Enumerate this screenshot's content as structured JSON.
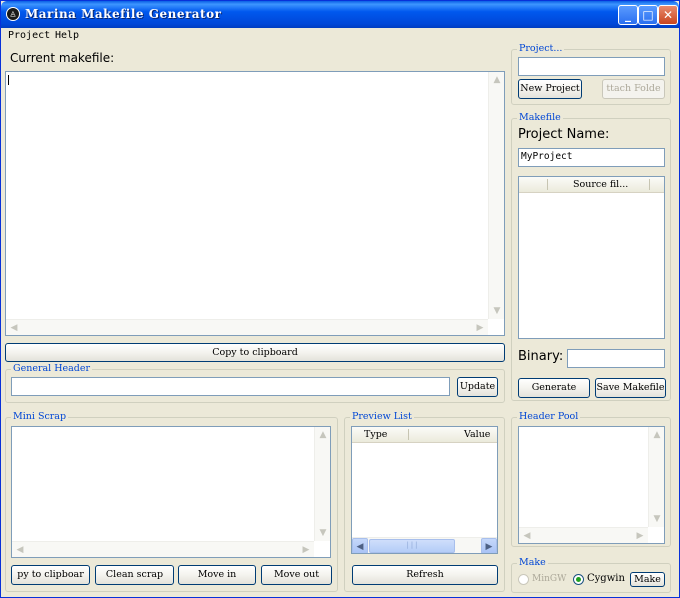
{
  "window": {
    "title": "Marina Makefile Generator"
  },
  "menu": {
    "items": [
      "Project",
      "Help"
    ]
  },
  "makefile": {
    "label": "Current makefile:",
    "copy_button": "Copy to clipboard"
  },
  "general_header": {
    "title": "General Header",
    "value": "",
    "update_button": "Update"
  },
  "mini_scrap": {
    "title": "Mini Scrap",
    "buttons": [
      "py to clipboar",
      "Clean scrap",
      "Move in",
      "Move out"
    ]
  },
  "preview_list": {
    "title": "Preview List",
    "columns": [
      "Type",
      "Value"
    ],
    "refresh_button": "Refresh"
  },
  "project": {
    "title": "Project...",
    "path_value": "",
    "new_button": "New Project",
    "attach_button": "ttach Folde"
  },
  "makefile_group": {
    "title": "Makefile",
    "project_name_label": "Project Name:",
    "project_name_value": "MyProject",
    "source_column": "Source fil...",
    "binary_label": "Binary:",
    "binary_value": "",
    "generate_button": "Generate",
    "save_button": "Save Makefile"
  },
  "header_pool": {
    "title": "Header Pool"
  },
  "make": {
    "title": "Make",
    "option_mingw": "MinGW",
    "option_cygwin": "Cygwin",
    "selected": "Cygwin",
    "make_button": "Make"
  },
  "colors": {
    "title_bar": "#0058ee",
    "group_title": "#0046d5",
    "background": "#ece9d8"
  }
}
